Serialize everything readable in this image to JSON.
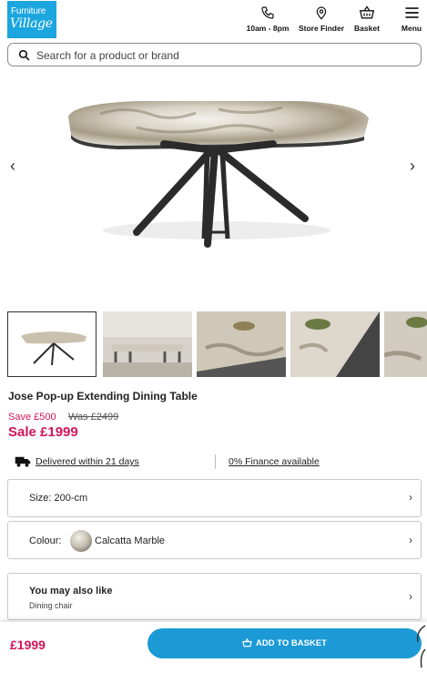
{
  "brand": {
    "line1": "Furniture",
    "line2": "Village",
    "color": "#1ba6df"
  },
  "header": {
    "hours_label": "10am - 8pm",
    "store_finder_label": "Store Finder",
    "basket_label": "Basket",
    "menu_label": "Menu",
    "icons": [
      "phone-icon",
      "location-pin-icon",
      "basket-icon",
      "hamburger-menu-icon"
    ]
  },
  "search": {
    "placeholder": "Search for a product or brand"
  },
  "gallery": {
    "prev_icon": "‹",
    "next_icon": "›",
    "thumbnails": [
      "Table cutout",
      "Dining room scene",
      "Table top close-up",
      "Marble top close-up",
      "Marble edge close-up"
    ]
  },
  "product": {
    "title": "Jose Pop-up Extending Dining Table",
    "save": "Save £500",
    "was": "Was £2499",
    "sale": "Sale £1999",
    "accent_color": "#d4145a"
  },
  "services": {
    "delivery": "Delivered within 21 days",
    "finance": "0% Finance available"
  },
  "options": {
    "size": "Size: 200-cm",
    "colour_label": "Colour:",
    "colour_value": "Calcatta Marble",
    "chevron": "›"
  },
  "also_like": {
    "title": "You may also like",
    "subtitle": "Dining chair"
  },
  "footer_bar": {
    "price": "£1999",
    "add_label": "ADD TO BASKET",
    "button_color": "#1b9ad6"
  }
}
